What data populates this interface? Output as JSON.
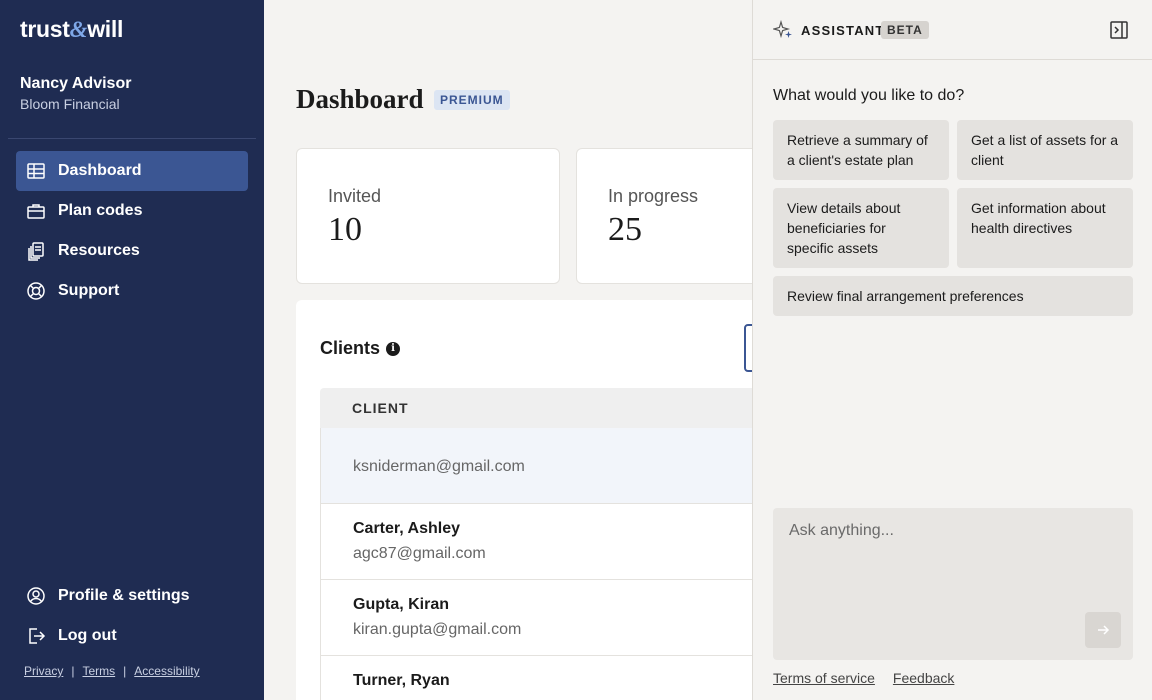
{
  "brand": {
    "logo_left": "trust",
    "logo_amp": "&",
    "logo_right": "will"
  },
  "user": {
    "name": "Nancy Advisor",
    "org": "Bloom Financial"
  },
  "sidebar": {
    "items": [
      {
        "label": "Dashboard",
        "icon": "table-icon",
        "active": true
      },
      {
        "label": "Plan codes",
        "icon": "briefcase-icon",
        "active": false
      },
      {
        "label": "Resources",
        "icon": "documents-icon",
        "active": false
      },
      {
        "label": "Support",
        "icon": "lifebuoy-icon",
        "active": false
      }
    ],
    "bottom_items": [
      {
        "label": "Profile & settings",
        "icon": "user-circle-icon"
      },
      {
        "label": "Log out",
        "icon": "logout-icon"
      }
    ],
    "footer_links": {
      "privacy": "Privacy",
      "terms": "Terms",
      "accessibility": "Accessibility"
    }
  },
  "main": {
    "title": "Dashboard",
    "badge": "PREMIUM",
    "stats": [
      {
        "label": "Invited",
        "value": "10"
      },
      {
        "label": "In progress",
        "value": "25"
      }
    ],
    "clients": {
      "title": "Clients",
      "column_header": "CLIENT",
      "rows": [
        {
          "name": "",
          "email": "ksniderman@gmail.com"
        },
        {
          "name": "Carter, Ashley",
          "email": "agc87@gmail.com"
        },
        {
          "name": "Gupta, Kiran",
          "email": "kiran.gupta@gmail.com"
        },
        {
          "name": "Turner, Ryan",
          "email": ""
        }
      ]
    }
  },
  "assistant": {
    "title": "ASSISTANT",
    "badge": "BETA",
    "question": "What would you like to do?",
    "suggestions": [
      "Retrieve a summary of a client's estate plan",
      "Get a list of assets for a client",
      "View details about beneficiaries for specific assets",
      "Get information about health directives",
      "Review final arrangement preferences"
    ],
    "input_placeholder": "Ask anything...",
    "footer": {
      "terms": "Terms of service",
      "feedback": "Feedback"
    }
  }
}
